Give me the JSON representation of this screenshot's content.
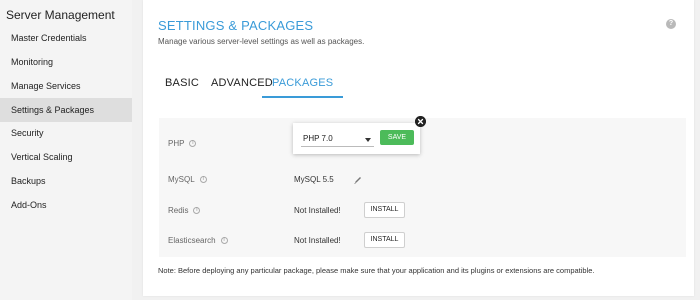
{
  "sidebar": {
    "title": "Server Management",
    "items": [
      {
        "label": "Master Credentials"
      },
      {
        "label": "Monitoring"
      },
      {
        "label": "Manage Services"
      },
      {
        "label": "Settings & Packages"
      },
      {
        "label": "Security"
      },
      {
        "label": "Vertical Scaling"
      },
      {
        "label": "Backups"
      },
      {
        "label": "Add-Ons"
      }
    ],
    "active_index": 3
  },
  "header": {
    "title": "SETTINGS & PACKAGES",
    "subtitle": "Manage various server-level settings as well as packages.",
    "help_icon": "?"
  },
  "tabs": [
    {
      "label": "BASIC"
    },
    {
      "label": "ADVANCED"
    },
    {
      "label": "PACKAGES"
    }
  ],
  "active_tab": "PACKAGES",
  "packages": {
    "info_glyph": "i",
    "php": {
      "label": "PHP",
      "selected": "PHP 7.0",
      "save_label": "SAVE"
    },
    "mysql": {
      "label": "MySQL",
      "value": "MySQL 5.5"
    },
    "redis": {
      "label": "Redis",
      "status": "Not Installed!",
      "button": "INSTALL"
    },
    "elasticsearch": {
      "label": "Elasticsearch",
      "status": "Not Installed!",
      "button": "INSTALL"
    }
  },
  "note": "Note: Before deploying any particular package, please make sure that your application and its plugins or extensions are compatible.",
  "colors": {
    "accent": "#3a9bd8",
    "save_green": "#4cbb5a",
    "active_sidebar": "#dedede"
  }
}
